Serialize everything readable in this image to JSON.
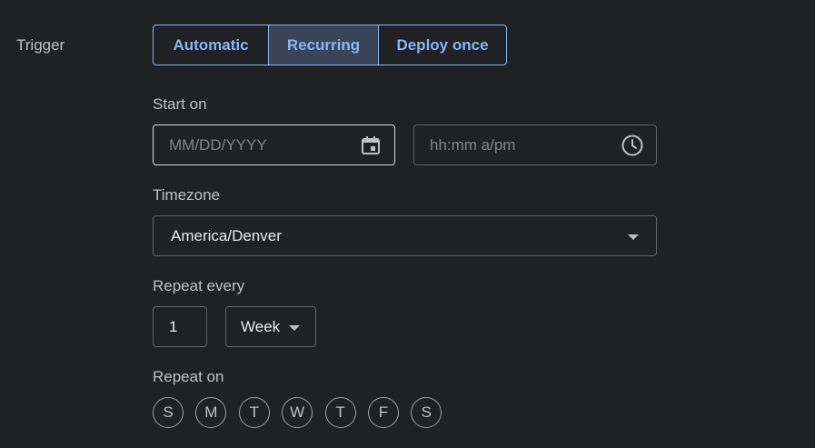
{
  "trigger": {
    "label": "Trigger",
    "options": [
      {
        "label": "Automatic",
        "selected": false
      },
      {
        "label": "Recurring",
        "selected": true
      },
      {
        "label": "Deploy once",
        "selected": false
      }
    ]
  },
  "start_on": {
    "label": "Start on",
    "date_placeholder": "MM/DD/YYYY",
    "date_value": "",
    "date_icon": "calendar-icon",
    "time_placeholder": "hh:mm a/pm",
    "time_value": "",
    "time_icon": "clock-icon"
  },
  "timezone": {
    "label": "Timezone",
    "value": "America/Denver"
  },
  "repeat_every": {
    "label": "Repeat every",
    "value": "1",
    "unit": "Week"
  },
  "repeat_on": {
    "label": "Repeat on",
    "days": [
      "S",
      "M",
      "T",
      "W",
      "T",
      "F",
      "S"
    ]
  },
  "colors": {
    "background": "#202124",
    "accent": "#8ab4f8",
    "selected_segment": "#394457"
  }
}
